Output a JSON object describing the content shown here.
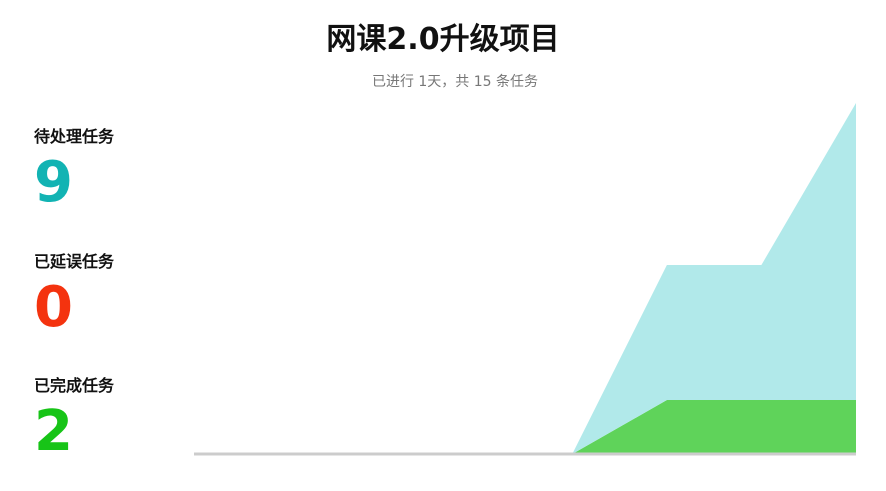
{
  "header": {
    "title": "网课2.0升级项目",
    "subtitle": "已进行 1天，共 15 条任务"
  },
  "stats": {
    "pending": {
      "label": "待处理任务",
      "value": "9",
      "color": "#12b3b3"
    },
    "delayed": {
      "label": "已延误任务",
      "value": "0",
      "color": "#f4330f"
    },
    "completed": {
      "label": "已完成任务",
      "value": "2",
      "color": "#17c417"
    }
  },
  "chart_data": {
    "type": "area",
    "stacked": true,
    "x": [
      0,
      1,
      2,
      3,
      4,
      5,
      6,
      7
    ],
    "series": [
      {
        "values": [
          0,
          0,
          0,
          0,
          0,
          2,
          2,
          2
        ],
        "color": "#5fd35a"
      },
      {
        "values": [
          0,
          0,
          0,
          0,
          0,
          5,
          5,
          11
        ],
        "color": "#b1e9ea"
      }
    ],
    "ylim": [
      0,
      13
    ],
    "axis_color": "#cccccc",
    "grid": false
  }
}
